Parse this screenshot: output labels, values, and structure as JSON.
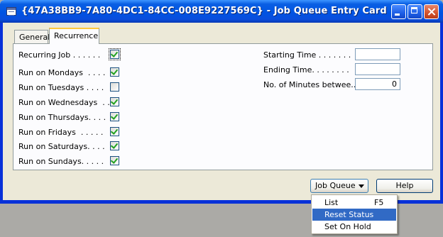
{
  "window": {
    "title": "{47A38BB9-7A80-4DC1-84CC-008E9227569C} - Job Queue Entry Card"
  },
  "tabs": [
    {
      "label": "General",
      "active": false
    },
    {
      "label": "Recurrence",
      "active": true
    }
  ],
  "recurrence": {
    "left_fields": [
      {
        "label": "Recurring Job . . . . . .",
        "checked": true
      },
      {
        "label": "Run on Mondays  . . . .",
        "checked": true
      },
      {
        "label": "Run on Tuesdays . . . .",
        "checked": false
      },
      {
        "label": "Run on Wednesdays  . .",
        "checked": true
      },
      {
        "label": "Run on Thursdays. . . .",
        "checked": true
      },
      {
        "label": "Run on Fridays  . . . . .",
        "checked": true
      },
      {
        "label": "Run on Saturdays. . . .",
        "checked": true
      },
      {
        "label": "Run on Sundays. . . . .",
        "checked": true
      }
    ],
    "right_fields": [
      {
        "label": "Starting Time . . . . . . .",
        "value": ""
      },
      {
        "label": "Ending Time. . . . . . . .",
        "value": ""
      },
      {
        "label": "No. of Minutes betwee...",
        "value": "0"
      }
    ]
  },
  "buttons": {
    "job_queue": "Job Queue",
    "help": "Help"
  },
  "job_queue_menu": [
    {
      "label": "List",
      "shortcut": "F5",
      "selected": false
    },
    {
      "label": "Reset Status",
      "shortcut": "",
      "selected": true
    },
    {
      "label": "Set On Hold",
      "shortcut": "",
      "selected": false
    }
  ]
}
